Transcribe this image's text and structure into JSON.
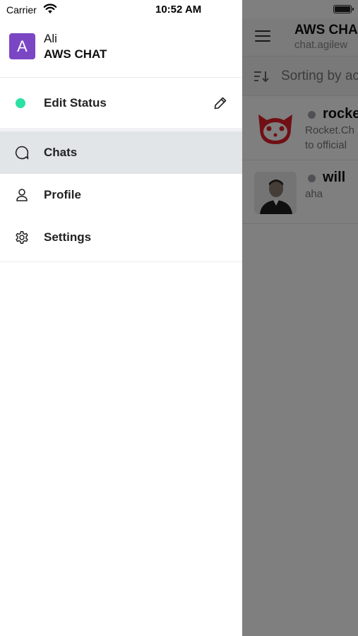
{
  "status_bar": {
    "carrier": "Carrier",
    "time": "10:52 AM"
  },
  "drawer": {
    "avatar_letter": "A",
    "user_name": "Ali",
    "server_name": "AWS CHAT",
    "status_item": {
      "label": "Edit Status",
      "indicator_color": "#2de0a5",
      "action_icon": "pencil-icon"
    },
    "menu": [
      {
        "label": "Chats",
        "icon": "chat-bubble-icon",
        "active": true
      },
      {
        "label": "Profile",
        "icon": "user-icon",
        "active": false
      },
      {
        "label": "Settings",
        "icon": "gear-icon",
        "active": false
      }
    ]
  },
  "background": {
    "server_title": "AWS CHA",
    "server_url": "chat.agilew",
    "sort_label": "Sorting by ac",
    "chats": [
      {
        "name": "rocke",
        "preview_line1": "Rocket.Ch",
        "preview_line2": "to official",
        "avatar": "rocket-cat-avatar"
      },
      {
        "name": "will",
        "preview_line1": "aha",
        "avatar": "user-photo-avatar"
      }
    ]
  },
  "colors": {
    "accent_avatar": "#7b46c4",
    "online_status": "#2de0a5",
    "active_item_bg": "#e1e5e8",
    "overlay": "rgba(0,0,0,0.5)"
  }
}
